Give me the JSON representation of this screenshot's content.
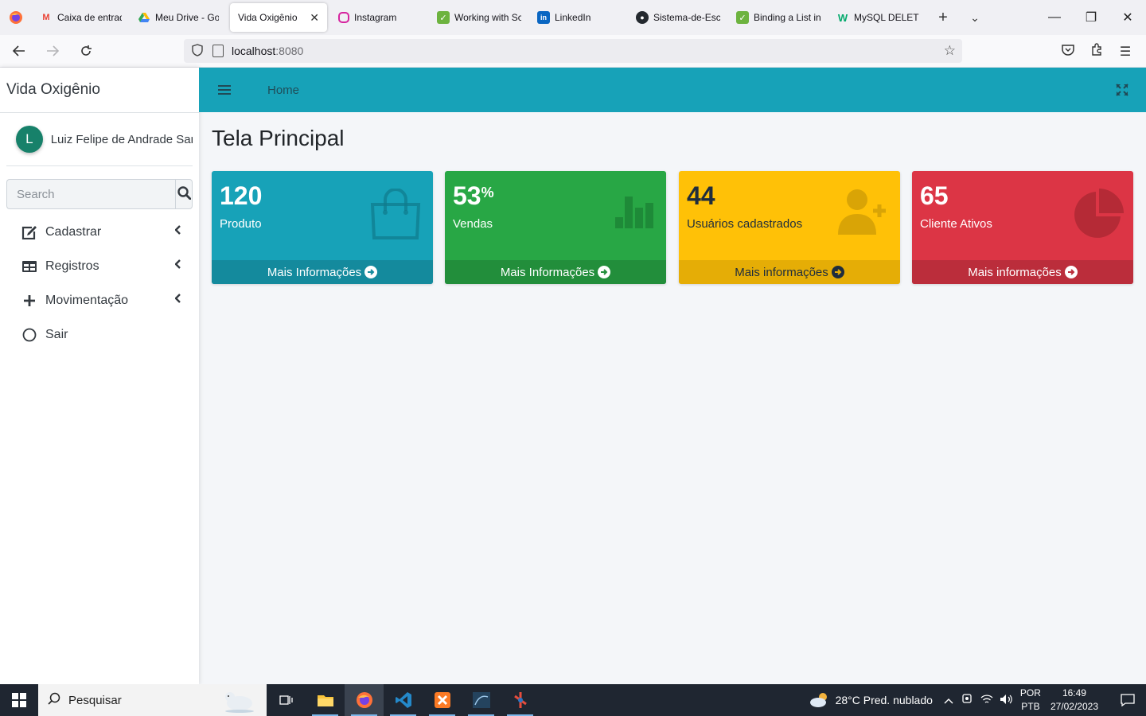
{
  "browser": {
    "tabs": [
      {
        "title": "Caixa de entrad",
        "icon": "gmail-icon"
      },
      {
        "title": "Meu Drive - Goo",
        "icon": "google-drive-icon"
      },
      {
        "title": "Vida Oxigênio",
        "icon": "none",
        "active": true
      },
      {
        "title": "Instagram",
        "icon": "instagram-icon"
      },
      {
        "title": "Working with Sc",
        "icon": "spring-icon"
      },
      {
        "title": "LinkedIn",
        "icon": "linkedin-icon"
      },
      {
        "title": "Sistema-de-Esc",
        "icon": "github-icon"
      },
      {
        "title": "Binding a List in",
        "icon": "spring-icon"
      },
      {
        "title": "MySQL DELETE",
        "icon": "w3schools-icon"
      }
    ],
    "url_host": "localhost",
    "url_port": ":8080"
  },
  "sidebar": {
    "brand": "Vida Oxigênio",
    "user": {
      "initial": "L",
      "name": "Luiz Felipe de Andrade Santos"
    },
    "search_placeholder": "Search",
    "menu": [
      {
        "label": "Cadastrar",
        "icon": "edit-icon",
        "has_submenu": true
      },
      {
        "label": "Registros",
        "icon": "table-icon",
        "has_submenu": true
      },
      {
        "label": "Movimentação",
        "icon": "plus-icon",
        "has_submenu": true
      },
      {
        "label": "Sair",
        "icon": "circle-icon",
        "has_submenu": false
      }
    ]
  },
  "header": {
    "home": "Home"
  },
  "page": {
    "title": "Tela Principal"
  },
  "boxes": [
    {
      "value": "120",
      "suffix": "",
      "label": "Produto",
      "link": "Mais Informações",
      "icon": "shopping-bag-icon",
      "color": "#17a2b8"
    },
    {
      "value": "53",
      "suffix": "%",
      "label": "Vendas",
      "link": "Mais Informações",
      "icon": "bar-chart-icon",
      "color": "#28a745"
    },
    {
      "value": "44",
      "suffix": "",
      "label": "Usuários cadastrados",
      "link": "Mais informações",
      "icon": "user-plus-icon",
      "color": "#ffc107"
    },
    {
      "value": "65",
      "suffix": "",
      "label": "Cliente Ativos",
      "link": "Mais informações",
      "icon": "pie-chart-icon",
      "color": "#dc3545"
    }
  ],
  "taskbar": {
    "search_placeholder": "Pesquisar",
    "weather": "28°C  Pred. nublado",
    "lang_1": "POR",
    "lang_2": "PTB",
    "time": "16:49",
    "date": "27/02/2023"
  }
}
